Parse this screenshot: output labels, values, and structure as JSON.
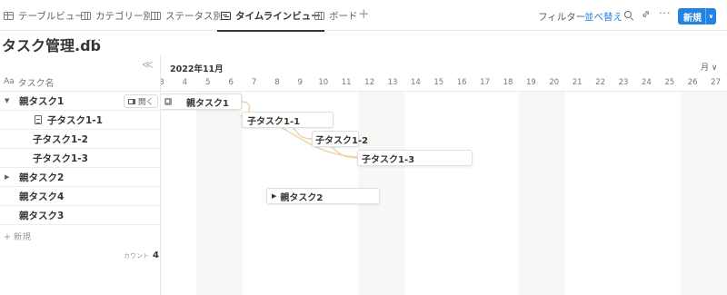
{
  "tabs": [
    {
      "label": "テーブルビュー",
      "icon": "table-icon"
    },
    {
      "label": "カテゴリー別",
      "icon": "board-icon"
    },
    {
      "label": "ステータス別",
      "icon": "board-icon"
    },
    {
      "label": "タイムラインビュー",
      "icon": "timeline-icon",
      "active": true
    },
    {
      "label": "ボード",
      "icon": "board-icon"
    }
  ],
  "toolbar": {
    "add_view": "+",
    "filter": "フィルター",
    "sort": "並べ替え",
    "more": "···",
    "new_label": "新規",
    "new_arrow": "∨"
  },
  "database": {
    "title": "タスク管理.db",
    "title_more": "···"
  },
  "table": {
    "collapse_icon": "≪",
    "column_icon": "Aa",
    "column_name": "タスク名",
    "open_label": "開く",
    "rows": [
      {
        "label": "親タスク1",
        "toggle": "▼"
      },
      {
        "label": "子タスク1-1"
      },
      {
        "label": "子タスク1-2"
      },
      {
        "label": "子タスク1-3"
      },
      {
        "label": "親タスク2",
        "toggle": "▶"
      },
      {
        "label": "親タスク4"
      },
      {
        "label": "親タスク3"
      }
    ],
    "new_row": "+ 新規",
    "count_label": "カウント",
    "count_value": "4"
  },
  "timeline": {
    "month": "2022年11月",
    "scale": "月 ∨",
    "days": [
      "3",
      "4",
      "5",
      "6",
      "7",
      "8",
      "9",
      "10",
      "11",
      "12",
      "13",
      "14",
      "15",
      "16",
      "17",
      "18",
      "19",
      "20",
      "21",
      "22",
      "23",
      "24",
      "25",
      "26",
      "27"
    ],
    "bars": [
      {
        "label": "親タスク1",
        "start": "3",
        "end": "6"
      },
      {
        "label": "子タスク1-1",
        "start": "7",
        "end": "10"
      },
      {
        "label": "子タスク1-2",
        "start": "9",
        "end": "11"
      },
      {
        "label": "子タスク1-3",
        "start": "11",
        "end": "16"
      },
      {
        "label": "親タスク2",
        "start": "8",
        "end": "12",
        "toggle": "▶"
      }
    ],
    "colors": {
      "dependency": "#f0d3a8",
      "shade": "#f7f7f5",
      "accent": "#2383e2"
    }
  }
}
